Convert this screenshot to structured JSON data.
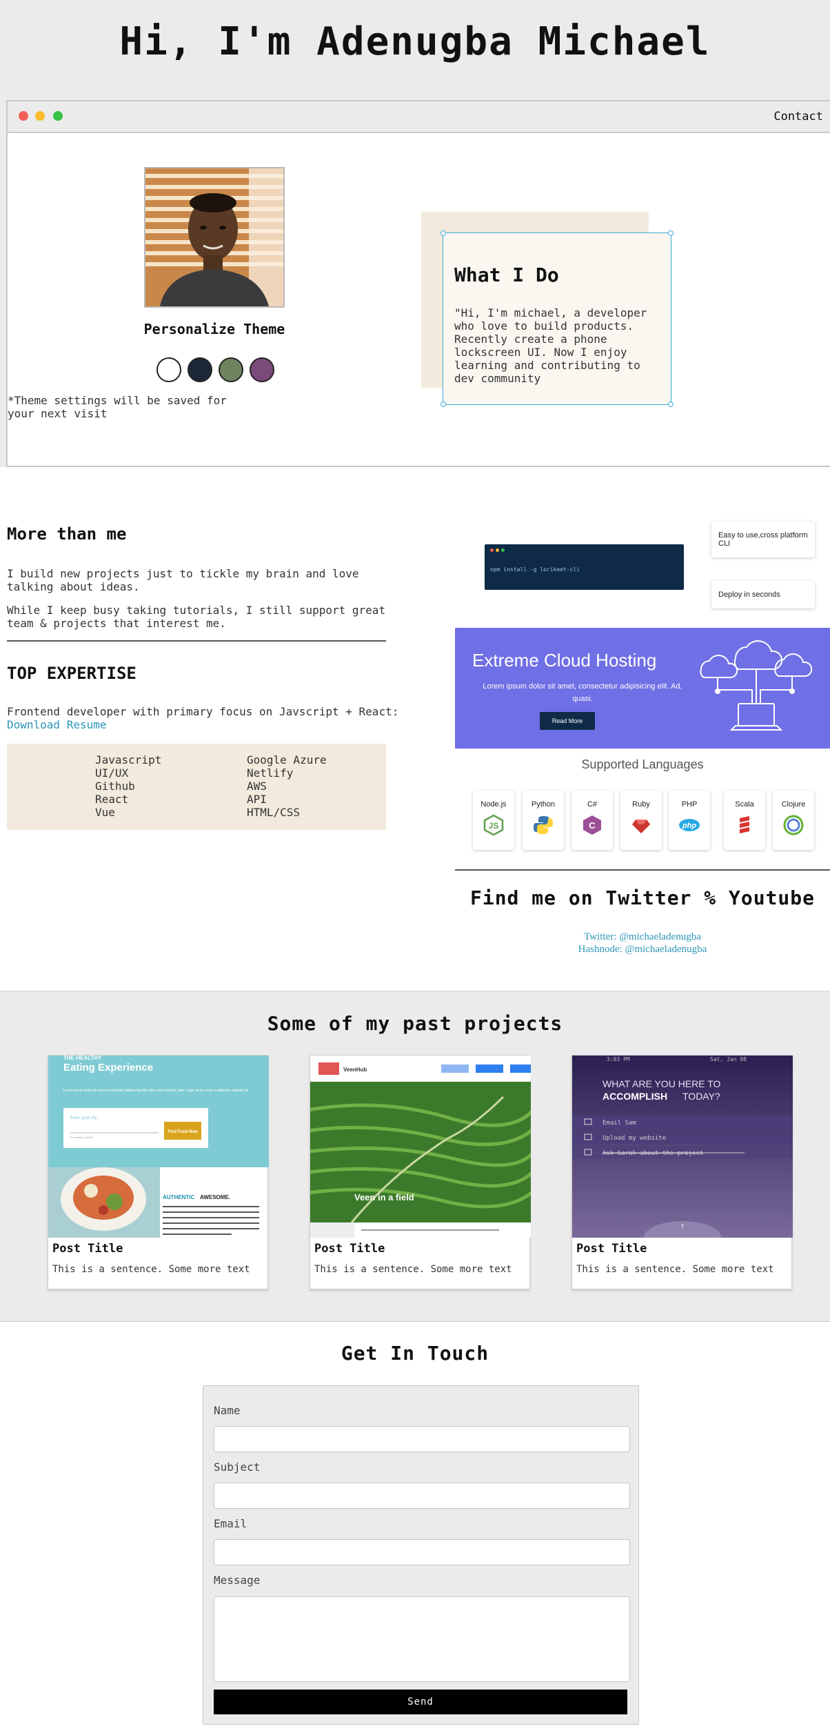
{
  "hero": {
    "title": "Hi, I'm Adenugba Michael"
  },
  "nav": {
    "contact": "Contact"
  },
  "theme": {
    "title": "Personalize Theme",
    "note": "*Theme settings will be saved for your next visit",
    "swatches": [
      "#ffffff",
      "#1c2738",
      "#6e8460",
      "#7b4a7a"
    ]
  },
  "what_i_do": {
    "title": "What I Do",
    "text": "\"Hi, I'm michael, a developer who love to build products. Recently create a phone lockscreen UI. Now I enjoy learning and contributing to dev community"
  },
  "more": {
    "title": "More than me",
    "p1": "I build new projects just to tickle my brain and love talking about ideas.",
    "p2": "While I keep busy taking tutorials, I still support great team & projects that interest me."
  },
  "expertise": {
    "title": "TOP EXPERTISE",
    "text": "Frontend developer with primary focus on Javscript + React:",
    "resume_link": "Download Resume",
    "left": [
      "Javascript",
      "UI/UX",
      "Github",
      "React",
      "Vue"
    ],
    "right": [
      "Google Azure",
      "Netlify",
      "AWS",
      "API",
      "HTML/CSS"
    ]
  },
  "cli": {
    "command": "npm install -g lorikeet-cli",
    "card_1": "Easy to use,cross platform CLI",
    "card_2": "Deploy in seconds"
  },
  "cloud": {
    "title": "Extreme Cloud Hosting",
    "subtitle": "Lorem ipsum dolor sit amet, consectetur adipisicing elit. Ad, quasi.",
    "button": "Read More",
    "color": "#6f6fe6"
  },
  "languages": {
    "title": "Supported Languages",
    "items": [
      "Node.js",
      "Python",
      "C#",
      "Ruby",
      "PHP",
      "Scala",
      "Clojure"
    ]
  },
  "social": {
    "title": "Find me on Twitter % Youtube",
    "twitter": "Twitter: @michaeladenugba",
    "hashnode": "Hashnode: @michaeladenugba"
  },
  "projects": {
    "title": "Some of my past projects",
    "items": [
      {
        "post_title": "Post Title",
        "desc": "This is a sentence. Some more text",
        "thumb": {
          "kicker": "THE HEALTHY",
          "heading": "Eating Experience",
          "blurb": "Lorem ipsum dolor sit amet consectetur adipisicing elit, aliter enim mutem, opitr, major lectus nese rosdibenim stipinatc at",
          "city_label": "Enter your city:",
          "city_hint": "Ex ample: 1 apt 87",
          "button": "Find Food Now",
          "section_title": "AUTHENTIC",
          "section_title_2": "AWESOME."
        }
      },
      {
        "post_title": "Post Title",
        "desc": "This is a sentence. Some more text",
        "thumb": {
          "brand": "VeenHub",
          "caption": "Veen in a field"
        }
      },
      {
        "post_title": "Post Title",
        "desc": "This is a sentence. Some more text",
        "thumb": {
          "time": "3:03 PM",
          "date": "Sat, Jan 08",
          "question": "WHAT ARE YOU HERE TO",
          "question_bold": "ACCOMPLISH",
          "question_end": "TODAY?",
          "tasks": [
            "Email Sam",
            "Upload my website",
            "Ask Sarah about the project"
          ]
        }
      }
    ]
  },
  "contact": {
    "title": "Get In Touch",
    "name_label": "Name",
    "subject_label": "Subject",
    "email_label": "Email",
    "message_label": "Message",
    "send": "Send"
  }
}
